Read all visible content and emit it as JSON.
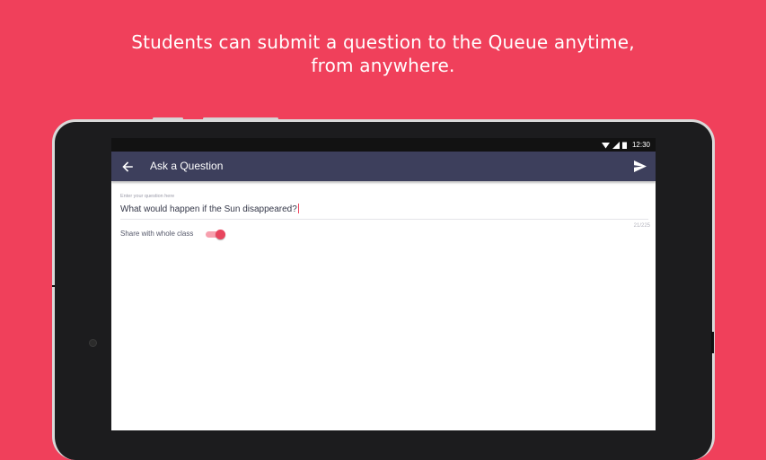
{
  "headline": {
    "line1": "Students can submit a question to the Queue anytime,",
    "line2": "from anywhere."
  },
  "status_bar": {
    "time": "12:30",
    "icons": [
      "wifi-icon",
      "signal-icon",
      "battery-icon"
    ]
  },
  "app_bar": {
    "title": "Ask a Question",
    "back_icon": "arrow-left-icon",
    "send_icon": "send-icon"
  },
  "question_field": {
    "placeholder": "Enter your question here",
    "value": "What would happen if the Sun disappeared?",
    "counter": "21/225"
  },
  "share_toggle": {
    "label": "Share with whole class",
    "on": true
  },
  "colors": {
    "background": "#f0405b",
    "app_bar": "#3d3f5c",
    "accent": "#e8455e"
  }
}
